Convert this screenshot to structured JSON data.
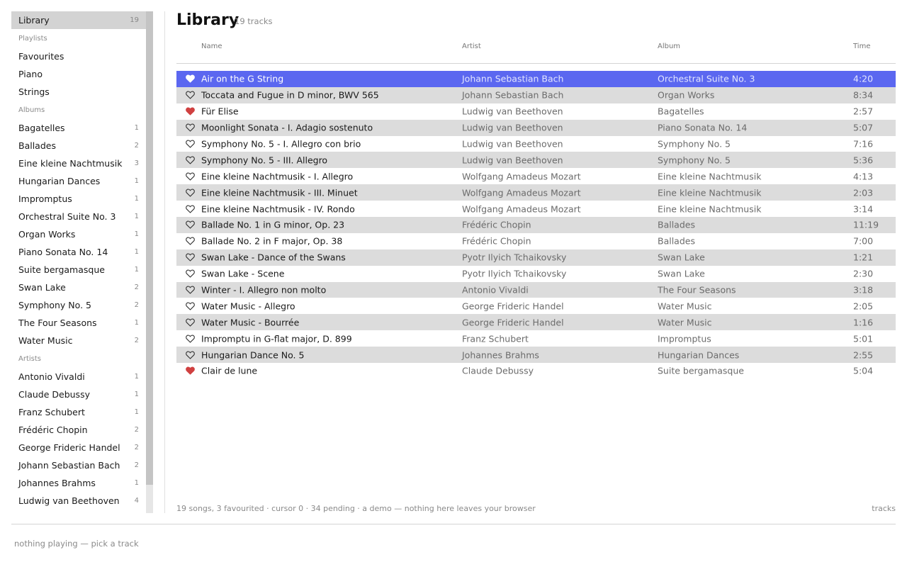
{
  "sidebar": {
    "library": {
      "label": "Library",
      "count": "19"
    },
    "playlists_heading": "Playlists",
    "playlists": [
      "Favourites",
      "Piano",
      "Strings"
    ],
    "albums_heading": "Albums",
    "albums": [
      {
        "label": "Bagatelles",
        "count": "1"
      },
      {
        "label": "Ballades",
        "count": "2"
      },
      {
        "label": "Eine kleine Nachtmusik",
        "count": "3"
      },
      {
        "label": "Hungarian Dances",
        "count": "1"
      },
      {
        "label": "Impromptus",
        "count": "1"
      },
      {
        "label": "Orchestral Suite No. 3",
        "count": "1"
      },
      {
        "label": "Organ Works",
        "count": "1"
      },
      {
        "label": "Piano Sonata No. 14",
        "count": "1"
      },
      {
        "label": "Suite bergamasque",
        "count": "1"
      },
      {
        "label": "Swan Lake",
        "count": "2"
      },
      {
        "label": "Symphony No. 5",
        "count": "2"
      },
      {
        "label": "The Four Seasons",
        "count": "1"
      },
      {
        "label": "Water Music",
        "count": "2"
      }
    ],
    "artists_heading": "Artists",
    "artists": [
      {
        "label": "Antonio Vivaldi",
        "count": "1"
      },
      {
        "label": "Claude Debussy",
        "count": "1"
      },
      {
        "label": "Franz Schubert",
        "count": "1"
      },
      {
        "label": "Frédéric Chopin",
        "count": "2"
      },
      {
        "label": "George Frideric Handel",
        "count": "2"
      },
      {
        "label": "Johann Sebastian Bach",
        "count": "2"
      },
      {
        "label": "Johannes Brahms",
        "count": "1"
      },
      {
        "label": "Ludwig van Beethoven",
        "count": "4"
      }
    ]
  },
  "main": {
    "title": "Library",
    "subtitle": "19 tracks",
    "columns": {
      "name": "Name",
      "artist": "Artist",
      "album": "Album",
      "time": "Time"
    },
    "tracks": [
      {
        "name": "Air on the G String",
        "artist": "Johann Sebastian Bach",
        "album": "Orchestral Suite No. 3",
        "time": "4:20",
        "fav": false,
        "selected": true
      },
      {
        "name": "Toccata and Fugue in D minor, BWV 565",
        "artist": "Johann Sebastian Bach",
        "album": "Organ Works",
        "time": "8:34",
        "fav": false
      },
      {
        "name": "Für Elise",
        "artist": "Ludwig van Beethoven",
        "album": "Bagatelles",
        "time": "2:57",
        "fav": true
      },
      {
        "name": "Moonlight Sonata - I. Adagio sostenuto",
        "artist": "Ludwig van Beethoven",
        "album": "Piano Sonata No. 14",
        "time": "5:07",
        "fav": false
      },
      {
        "name": "Symphony No. 5 - I. Allegro con brio",
        "artist": "Ludwig van Beethoven",
        "album": "Symphony No. 5",
        "time": "7:16",
        "fav": false
      },
      {
        "name": "Symphony No. 5 - III. Allegro",
        "artist": "Ludwig van Beethoven",
        "album": "Symphony No. 5",
        "time": "5:36",
        "fav": false
      },
      {
        "name": "Eine kleine Nachtmusik - I. Allegro",
        "artist": "Wolfgang Amadeus Mozart",
        "album": "Eine kleine Nachtmusik",
        "time": "4:13",
        "fav": false
      },
      {
        "name": "Eine kleine Nachtmusik - III. Minuet",
        "artist": "Wolfgang Amadeus Mozart",
        "album": "Eine kleine Nachtmusik",
        "time": "2:03",
        "fav": false
      },
      {
        "name": "Eine kleine Nachtmusik - IV. Rondo",
        "artist": "Wolfgang Amadeus Mozart",
        "album": "Eine kleine Nachtmusik",
        "time": "3:14",
        "fav": false
      },
      {
        "name": "Ballade No. 1 in G minor, Op. 23",
        "artist": "Frédéric Chopin",
        "album": "Ballades",
        "time": "11:19",
        "fav": false
      },
      {
        "name": "Ballade No. 2 in F major, Op. 38",
        "artist": "Frédéric Chopin",
        "album": "Ballades",
        "time": "7:00",
        "fav": false
      },
      {
        "name": "Swan Lake - Dance of the Swans",
        "artist": "Pyotr Ilyich Tchaikovsky",
        "album": "Swan Lake",
        "time": "1:21",
        "fav": false
      },
      {
        "name": "Swan Lake - Scene",
        "artist": "Pyotr Ilyich Tchaikovsky",
        "album": "Swan Lake",
        "time": "2:30",
        "fav": false
      },
      {
        "name": "Winter - I. Allegro non molto",
        "artist": "Antonio Vivaldi",
        "album": "The Four Seasons",
        "time": "3:18",
        "fav": false
      },
      {
        "name": "Water Music - Allegro",
        "artist": "George Frideric Handel",
        "album": "Water Music",
        "time": "2:05",
        "fav": false
      },
      {
        "name": "Water Music - Bourrée",
        "artist": "George Frideric Handel",
        "album": "Water Music",
        "time": "1:16",
        "fav": false
      },
      {
        "name": "Impromptu in G-flat major, D. 899",
        "artist": "Franz Schubert",
        "album": "Impromptus",
        "time": "5:01",
        "fav": false
      },
      {
        "name": "Hungarian Dance No. 5",
        "artist": "Johannes Brahms",
        "album": "Hungarian Dances",
        "time": "2:55",
        "fav": false
      },
      {
        "name": "Clair de lune",
        "artist": "Claude Debussy",
        "album": "Suite bergamasque",
        "time": "5:04",
        "fav": true
      }
    ],
    "status_left": "19 songs, 3 favourited · cursor 0 · 34 pending  ·  a demo — nothing here leaves your browser",
    "status_right": "tracks"
  },
  "footer": {
    "now_playing": "nothing playing — pick a track"
  },
  "colors": {
    "accent": "#5b67f0",
    "fav": "#d04040"
  }
}
